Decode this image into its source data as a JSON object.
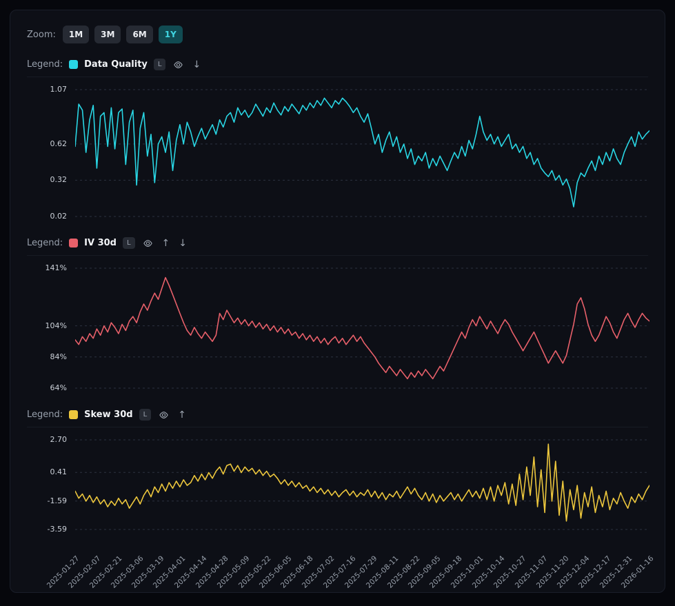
{
  "zoom": {
    "label": "Zoom:",
    "options": [
      {
        "label": "1M",
        "active": false
      },
      {
        "label": "3M",
        "active": false
      },
      {
        "label": "6M",
        "active": false
      },
      {
        "label": "1Y",
        "active": true
      }
    ]
  },
  "colors": {
    "card_bg": "#0d0f16",
    "page_bg": "#06070c",
    "active_zoom_bg": "#114b52",
    "active_zoom_text": "#40d6e2",
    "data_quality": "#29d6e4",
    "iv_30d": "#e8606a",
    "skew_30d": "#edc73d"
  },
  "panels": [
    {
      "legend_label": "Legend:",
      "series_name": "Data Quality",
      "badge": "L",
      "icons": [
        "log-badge",
        "eye-icon",
        "move-down-icon"
      ],
      "move_down_glyph": "↓"
    },
    {
      "legend_label": "Legend:",
      "series_name": "IV 30d",
      "badge": "L",
      "icons": [
        "log-badge",
        "eye-icon",
        "move-up-icon",
        "move-down-icon"
      ],
      "move_up_glyph": "↑",
      "move_down_glyph": "↓"
    },
    {
      "legend_label": "Legend:",
      "series_name": "Skew 30d",
      "badge": "L",
      "icons": [
        "log-badge",
        "eye-icon",
        "move-up-icon"
      ],
      "move_up_glyph": "↑"
    }
  ],
  "chart_data": [
    {
      "type": "line",
      "name": "Data Quality",
      "title": "",
      "xlabel": "",
      "ylabel": "",
      "color": "#29d6e4",
      "grid": "dashed-horizontal",
      "legend_position": "top-row",
      "ylim": [
        0.02,
        1.07
      ],
      "y_ticks": [
        {
          "label": "1.07",
          "value": 1.07
        },
        {
          "label": "0.62",
          "value": 0.62
        },
        {
          "label": "0.32",
          "value": 0.32
        },
        {
          "label": "0.02",
          "value": 0.02
        }
      ],
      "x_range": [
        "2025-01-27",
        "2026-01-16"
      ],
      "values": [
        0.6,
        0.95,
        0.9,
        0.55,
        0.82,
        0.94,
        0.42,
        0.85,
        0.88,
        0.6,
        0.92,
        0.58,
        0.88,
        0.91,
        0.45,
        0.8,
        0.9,
        0.28,
        0.75,
        0.88,
        0.52,
        0.7,
        0.3,
        0.62,
        0.68,
        0.55,
        0.72,
        0.4,
        0.65,
        0.78,
        0.62,
        0.8,
        0.72,
        0.6,
        0.68,
        0.75,
        0.66,
        0.72,
        0.78,
        0.7,
        0.82,
        0.76,
        0.85,
        0.88,
        0.8,
        0.92,
        0.86,
        0.9,
        0.84,
        0.88,
        0.95,
        0.9,
        0.85,
        0.92,
        0.88,
        0.96,
        0.9,
        0.86,
        0.93,
        0.89,
        0.95,
        0.91,
        0.87,
        0.94,
        0.9,
        0.96,
        0.92,
        0.98,
        0.94,
        1.0,
        0.96,
        0.92,
        0.98,
        0.95,
        1.0,
        0.97,
        0.93,
        0.88,
        0.92,
        0.85,
        0.8,
        0.87,
        0.75,
        0.62,
        0.7,
        0.55,
        0.65,
        0.72,
        0.6,
        0.68,
        0.55,
        0.62,
        0.5,
        0.58,
        0.45,
        0.52,
        0.48,
        0.55,
        0.42,
        0.5,
        0.44,
        0.52,
        0.46,
        0.4,
        0.48,
        0.55,
        0.5,
        0.6,
        0.52,
        0.65,
        0.58,
        0.7,
        0.85,
        0.72,
        0.65,
        0.7,
        0.62,
        0.68,
        0.6,
        0.65,
        0.7,
        0.58,
        0.62,
        0.55,
        0.6,
        0.5,
        0.55,
        0.45,
        0.5,
        0.42,
        0.38,
        0.35,
        0.4,
        0.32,
        0.36,
        0.28,
        0.33,
        0.25,
        0.1,
        0.3,
        0.38,
        0.35,
        0.42,
        0.48,
        0.4,
        0.52,
        0.45,
        0.55,
        0.48,
        0.58,
        0.5,
        0.45,
        0.55,
        0.62,
        0.68,
        0.6,
        0.72,
        0.66,
        0.7,
        0.73
      ]
    },
    {
      "type": "line",
      "name": "IV 30d",
      "title": "",
      "xlabel": "",
      "ylabel": "",
      "color": "#e8606a",
      "grid": "dashed-horizontal",
      "legend_position": "top-row",
      "ylim": [
        64,
        141
      ],
      "y_ticks": [
        {
          "label": "141%",
          "value": 141
        },
        {
          "label": "104%",
          "value": 104
        },
        {
          "label": "84%",
          "value": 84
        },
        {
          "label": "64%",
          "value": 64
        }
      ],
      "x_range": [
        "2025-01-27",
        "2026-01-16"
      ],
      "values": [
        95,
        92,
        97,
        94,
        99,
        96,
        102,
        98,
        104,
        100,
        106,
        103,
        99,
        105,
        101,
        107,
        110,
        106,
        113,
        118,
        114,
        120,
        125,
        121,
        128,
        135,
        130,
        124,
        118,
        112,
        106,
        101,
        98,
        103,
        99,
        96,
        100,
        97,
        94,
        98,
        112,
        108,
        114,
        110,
        106,
        109,
        105,
        108,
        104,
        107,
        103,
        106,
        102,
        105,
        101,
        104,
        100,
        103,
        99,
        102,
        98,
        100,
        96,
        99,
        95,
        98,
        94,
        97,
        93,
        96,
        92,
        95,
        97,
        93,
        96,
        92,
        95,
        98,
        94,
        97,
        93,
        90,
        87,
        84,
        80,
        77,
        74,
        78,
        75,
        72,
        76,
        73,
        70,
        74,
        71,
        75,
        72,
        76,
        73,
        70,
        74,
        78,
        75,
        80,
        85,
        90,
        95,
        100,
        96,
        103,
        108,
        104,
        110,
        106,
        102,
        107,
        103,
        99,
        104,
        108,
        105,
        100,
        96,
        92,
        88,
        92,
        96,
        100,
        95,
        90,
        85,
        80,
        84,
        88,
        84,
        80,
        85,
        95,
        105,
        118,
        122,
        115,
        105,
        98,
        94,
        98,
        104,
        110,
        106,
        100,
        96,
        102,
        108,
        112,
        107,
        103,
        108,
        112,
        109,
        107
      ]
    },
    {
      "type": "line",
      "name": "Skew 30d",
      "title": "",
      "xlabel": "",
      "ylabel": "",
      "color": "#edc73d",
      "grid": "dashed-horizontal",
      "legend_position": "top-row",
      "ylim": [
        -3.59,
        2.7
      ],
      "y_ticks": [
        {
          "label": "2.70",
          "value": 2.7
        },
        {
          "label": "0.41",
          "value": 0.41
        },
        {
          "label": "-1.59",
          "value": -1.59
        },
        {
          "label": "-3.59",
          "value": -3.59
        }
      ],
      "x_range": [
        "2025-01-27",
        "2026-01-16"
      ],
      "x_tick_labels": [
        "2025-01-27",
        "2025-02-07",
        "2025-02-21",
        "2025-03-06",
        "2025-03-19",
        "2025-04-01",
        "2025-04-14",
        "2025-04-28",
        "2025-05-09",
        "2025-05-22",
        "2025-06-05",
        "2025-06-18",
        "2025-07-02",
        "2025-07-16",
        "2025-07-29",
        "2025-08-11",
        "2025-08-22",
        "2025-09-05",
        "2025-09-18",
        "2025-10-01",
        "2025-10-14",
        "2025-10-27",
        "2025-11-07",
        "2025-11-20",
        "2025-12-04",
        "2025-12-17",
        "2025-12-31",
        "2026-01-16"
      ],
      "values": [
        -0.9,
        -1.4,
        -1.1,
        -1.6,
        -1.2,
        -1.7,
        -1.3,
        -1.8,
        -1.5,
        -2.0,
        -1.6,
        -1.9,
        -1.4,
        -1.8,
        -1.5,
        -2.1,
        -1.7,
        -1.3,
        -1.8,
        -1.2,
        -0.8,
        -1.3,
        -0.6,
        -1.0,
        -0.4,
        -0.9,
        -0.3,
        -0.7,
        -0.2,
        -0.6,
        -0.1,
        -0.5,
        -0.3,
        0.2,
        -0.2,
        0.3,
        -0.1,
        0.4,
        0.0,
        0.5,
        0.8,
        0.3,
        0.9,
        1.0,
        0.5,
        0.9,
        0.4,
        0.8,
        0.5,
        0.7,
        0.3,
        0.6,
        0.2,
        0.5,
        0.1,
        0.3,
        0.0,
        -0.4,
        -0.1,
        -0.5,
        -0.2,
        -0.6,
        -0.3,
        -0.7,
        -0.5,
        -0.9,
        -0.6,
        -1.0,
        -0.7,
        -1.1,
        -0.8,
        -1.2,
        -0.9,
        -1.3,
        -1.0,
        -0.8,
        -1.2,
        -0.9,
        -1.3,
        -1.0,
        -1.2,
        -0.8,
        -1.3,
        -0.9,
        -1.4,
        -1.0,
        -1.5,
        -1.1,
        -1.3,
        -0.9,
        -1.4,
        -1.0,
        -0.6,
        -1.1,
        -0.7,
        -1.2,
        -1.5,
        -1.0,
        -1.6,
        -1.1,
        -1.7,
        -1.2,
        -1.6,
        -1.3,
        -1.0,
        -1.5,
        -1.1,
        -1.6,
        -1.2,
        -0.8,
        -1.3,
        -0.9,
        -1.4,
        -0.7,
        -1.5,
        -0.6,
        -1.6,
        -0.5,
        -1.2,
        -0.3,
        -1.8,
        -0.4,
        -1.9,
        0.3,
        -1.5,
        0.8,
        -1.2,
        1.5,
        -2.0,
        0.6,
        -2.4,
        2.4,
        -1.6,
        1.2,
        -2.6,
        -0.2,
        -3.0,
        -0.8,
        -2.2,
        -0.5,
        -2.8,
        -1.0,
        -2.0,
        -0.6,
        -2.4,
        -1.2,
        -2.0,
        -0.9,
        -2.2,
        -1.4,
        -1.8,
        -1.0,
        -1.6,
        -2.1,
        -1.3,
        -1.7,
        -1.1,
        -1.5,
        -0.9,
        -0.5
      ]
    }
  ]
}
